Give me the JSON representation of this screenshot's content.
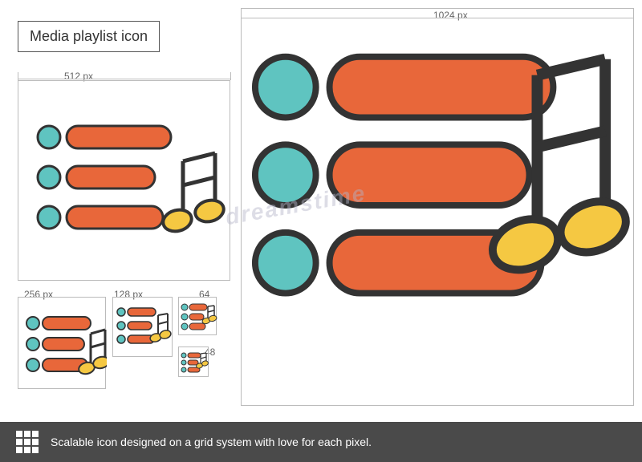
{
  "title": "Media playlist icon",
  "dimensions": {
    "large": "1024 px",
    "medium": "512 px",
    "small1": "256 px",
    "small2": "128 px",
    "small3": "64",
    "tiny": "48"
  },
  "bottom_text": "Scalable icon designed on a grid system with love for each pixel.",
  "watermark": "dreamstime"
}
